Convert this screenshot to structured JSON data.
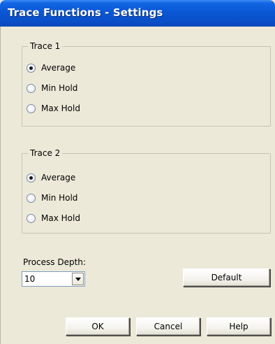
{
  "window": {
    "title": "Trace Functions - Settings"
  },
  "trace1": {
    "title": "Trace 1",
    "options": [
      "Average",
      "Min Hold",
      "Max Hold"
    ],
    "selected": "Average"
  },
  "trace2": {
    "title": "Trace 2",
    "options": [
      "Average",
      "Min Hold",
      "Max Hold"
    ],
    "selected": "Average"
  },
  "process_depth": {
    "label": "Process Depth:",
    "value": "10"
  },
  "buttons": {
    "default": "Default",
    "ok": "OK",
    "cancel": "Cancel",
    "help": "Help"
  },
  "colors": {
    "titlebar": "#0a57d4",
    "dialog_bg": "#ece9d8"
  },
  "icons": {
    "combo_dropdown": "chevron-down-icon"
  }
}
